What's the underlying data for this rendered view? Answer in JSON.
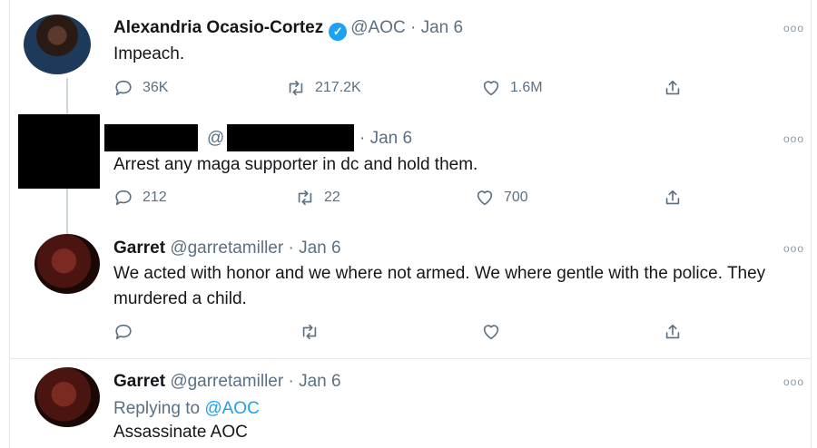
{
  "tweets": [
    {
      "name": "Alexandria Ocasio-Cortez",
      "handle": "@AOC",
      "dot": "·",
      "date": "Jan 6",
      "text": "Impeach.",
      "replies": "36K",
      "retweets": "217.2K",
      "likes": "1.6M",
      "verified": true
    },
    {
      "handle": "@",
      "dot": "·",
      "date": "Jan 6",
      "text": "Arrest any maga supporter in dc and hold them.",
      "replies": "212",
      "retweets": "22",
      "likes": "700"
    },
    {
      "name": "Garret",
      "handle": "@garretamiller",
      "dot": "·",
      "date": "Jan 6",
      "text": "We acted with honor and we where not armed. We where gentle with the police. They murdered a child.",
      "replies": "",
      "retweets": "",
      "likes": ""
    },
    {
      "name": "Garret",
      "handle": "@garretamiller",
      "dot": "·",
      "date": "Jan 6",
      "replying_prefix": "Replying to ",
      "replying_to": "@AOC",
      "text": "Assassinate AOC"
    }
  ],
  "icons": {
    "more": "more-options-icon",
    "reply": "reply-icon",
    "retweet": "retweet-icon",
    "like": "heart-icon",
    "share": "share-icon"
  },
  "colors": {
    "verified": "#1da1f2",
    "link": "#1da1f2",
    "secondary_text": "#5b7083"
  },
  "glyphs": {
    "more": "ooo",
    "verified_check": "✓"
  }
}
